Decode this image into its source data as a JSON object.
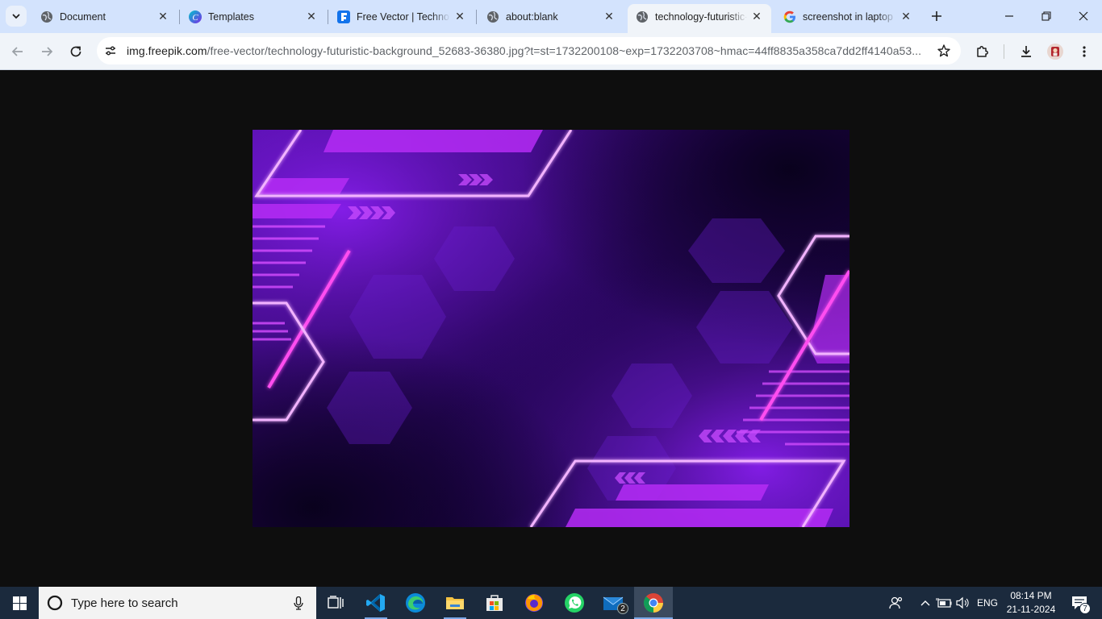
{
  "tabs": [
    {
      "title": "Document",
      "icon": "globe-icon",
      "active": false
    },
    {
      "title": "Templates",
      "icon": "canva-icon",
      "active": false
    },
    {
      "title": "Free Vector | Technology futuristic background",
      "icon": "freepik-icon",
      "active": false
    },
    {
      "title": "about:blank",
      "icon": "globe-icon",
      "active": false
    },
    {
      "title": "technology-futuristic-background",
      "icon": "globe-icon",
      "active": true
    },
    {
      "title": "screenshot in laptop",
      "icon": "google-icon",
      "active": false
    }
  ],
  "omnibox": {
    "host": "img.freepik.com",
    "path": "/free-vector/technology-futuristic-background_52683-36380.jpg?t=st=1732200108~exp=1732203708~hmac=44ff8835a358ca7dd2ff4140a53..."
  },
  "image": {
    "subject": "purple neon hexagon technology futuristic background"
  },
  "taskbar": {
    "search_placeholder": "Type here to search",
    "mail_badge": "2",
    "language": "ENG",
    "time": "08:14 PM",
    "date": "21-11-2024",
    "notification_count": "7"
  },
  "colors": {
    "tabstrip_bg": "#d3e3fd",
    "toolbar_bg": "#f0f4f9",
    "page_bg": "#0e0e0e",
    "taskbar_bg": "#1b2a3d",
    "neon_magenta": "#e040ff",
    "deep_purple": "#2a0660"
  }
}
